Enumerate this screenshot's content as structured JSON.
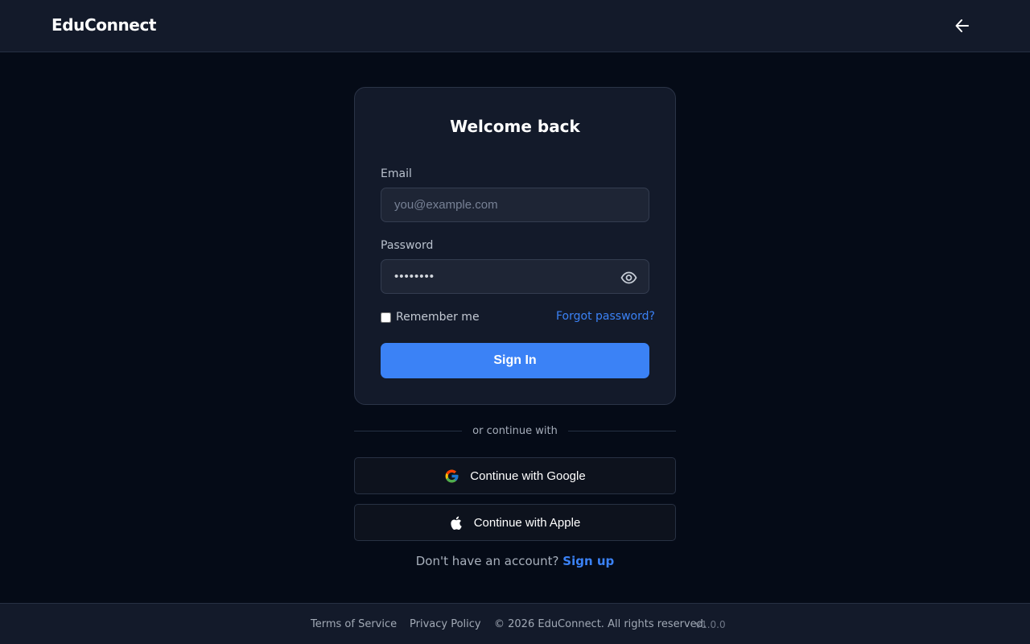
{
  "header": {
    "brand": "EduConnect",
    "back_icon": "arrow-left-icon"
  },
  "login_card": {
    "title": "Welcome back",
    "email_label": "Email",
    "email_placeholder": "you@example.com",
    "email_value": "",
    "password_label": "Password",
    "password_value": "••••••••",
    "password_toggle_icon": "eye-icon",
    "remember_label": "Remember me",
    "remember_checked": false,
    "forgot_link": "Forgot password?",
    "submit_label": "Sign In"
  },
  "divider_text": "or continue with",
  "social": {
    "google": {
      "label": "Continue with Google",
      "icon": "google-icon"
    },
    "apple": {
      "label": "Continue with Apple",
      "icon": "apple-icon"
    }
  },
  "signup": {
    "prompt": "Don't have an account?",
    "link": "Sign up"
  },
  "footer": {
    "terms": "Terms of Service",
    "privacy": "Privacy Policy",
    "copyright": "© 2026 EduConnect. All rights reserved.",
    "version": "v1.0.0"
  },
  "colors": {
    "background": "#050b17",
    "surface": "#131a2a",
    "accent": "#3b82f6",
    "input_background": "#1e2535"
  }
}
